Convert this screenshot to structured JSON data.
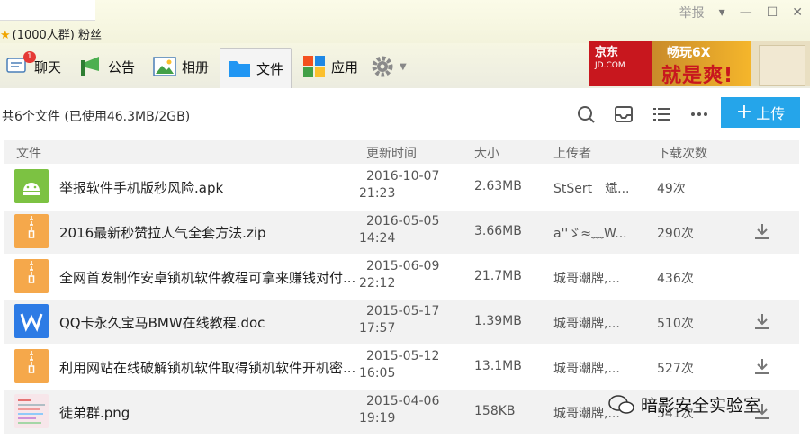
{
  "window": {
    "group_name": "",
    "fans": "(1000人群) 粉丝",
    "report": "举报",
    "controls": [
      "▾",
      "—",
      "☐",
      "✕"
    ]
  },
  "tabs": [
    {
      "label": "聊天",
      "icon": "chat-icon",
      "badge": "1"
    },
    {
      "label": "公告",
      "icon": "announcement-icon"
    },
    {
      "label": "相册",
      "icon": "album-icon"
    },
    {
      "label": "文件",
      "icon": "folder-icon",
      "active": true
    },
    {
      "label": "应用",
      "icon": "apps-icon"
    },
    {
      "label": "",
      "icon": "gear-icon"
    }
  ],
  "ad": {
    "brand": "京东",
    "brand_en": "JD.COM",
    "line1": "畅玩6X",
    "line2": "就是爽!"
  },
  "toolbar": {
    "summary": "共6个文件 (已使用46.3MB/2GB)",
    "upload_label": "上传"
  },
  "columns": [
    "文件",
    "更新时间",
    "大小",
    "上传者",
    "下载次数"
  ],
  "files": [
    {
      "name": "举报软件手机版秒风险.apk",
      "date": "2016-10-07",
      "time": "21:23",
      "size": "2.63MB",
      "uploader": "StSert　斌...",
      "downloads": "49次",
      "type": "apk",
      "downloadable": false
    },
    {
      "name": "2016最新秒赞拉人气全套方法.zip",
      "date": "2016-05-05",
      "time": "14:24",
      "size": "3.66MB",
      "uploader": "a''ゞ≈﹏W...",
      "downloads": "290次",
      "type": "zip",
      "downloadable": true
    },
    {
      "name": "全网首发制作安卓锁机软件教程可拿来赚钱对付...",
      "date": "2015-06-09",
      "time": "22:12",
      "size": "21.7MB",
      "uploader": "城哥潮牌,...",
      "downloads": "436次",
      "type": "zip",
      "downloadable": false
    },
    {
      "name": "QQ卡永久宝马BMW在线教程.doc",
      "date": "2015-05-17",
      "time": "17:57",
      "size": "1.39MB",
      "uploader": "城哥潮牌,...",
      "downloads": "510次",
      "type": "doc",
      "downloadable": true
    },
    {
      "name": "利用网站在线破解锁机软件取得锁机软件开机密...",
      "date": "2015-05-12",
      "time": "16:05",
      "size": "13.1MB",
      "uploader": "城哥潮牌,...",
      "downloads": "527次",
      "type": "zip",
      "downloadable": true
    },
    {
      "name": "徒弟群.png",
      "date": "2015-04-06",
      "time": "19:19",
      "size": "158KB",
      "uploader": "城哥潮牌,...",
      "downloads": "541次",
      "type": "png",
      "downloadable": true
    }
  ],
  "watermark": "暗影安全实验室",
  "colors": {
    "accent": "#25a5ea",
    "zip": "#f5a84b",
    "apk": "#7cc242",
    "doc": "#2d7be5"
  }
}
